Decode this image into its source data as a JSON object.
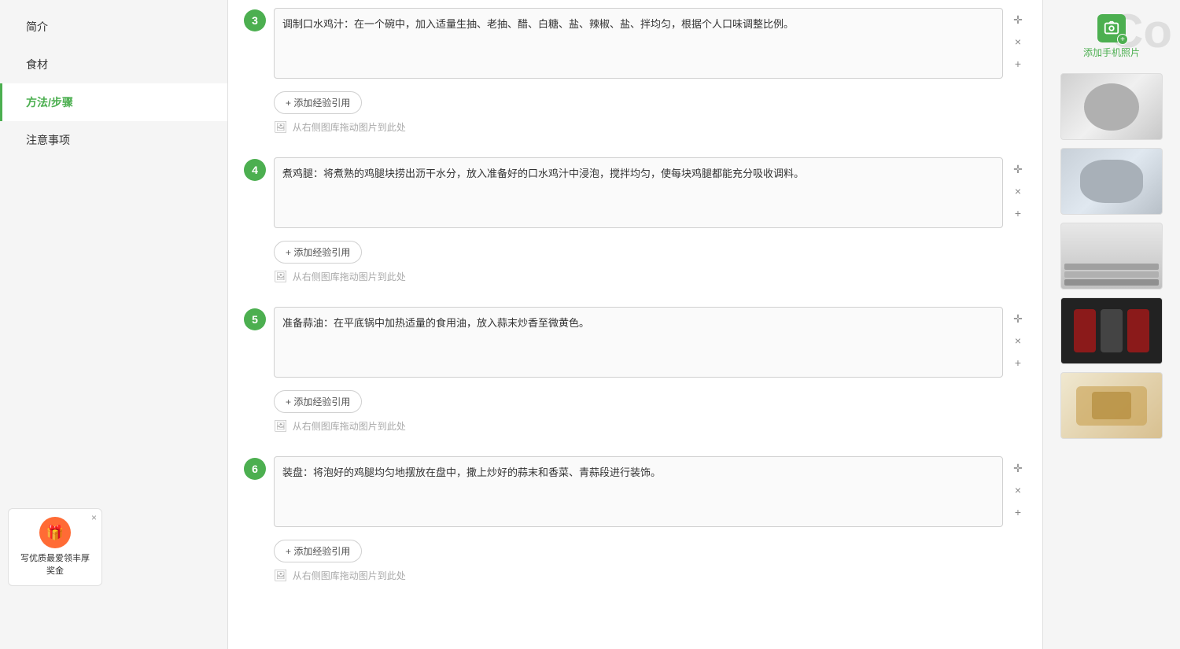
{
  "sidebar": {
    "items": [
      {
        "id": "intro",
        "label": "简介",
        "active": false
      },
      {
        "id": "ingredients",
        "label": "食材",
        "active": false
      },
      {
        "id": "method",
        "label": "方法/步骤",
        "active": true
      },
      {
        "id": "notes",
        "label": "注意事项",
        "active": false
      }
    ]
  },
  "award": {
    "close_symbol": "×",
    "icon": "🎁",
    "text": "写优质最爱领丰厚奖金"
  },
  "steps": [
    {
      "number": "3",
      "text": "调制口水鸡汁：在一个碗中，加入适量生抽、老抽、醋、白糖、盐、辣椒、盐、拌均匀，根据个人口味调整比例。",
      "add_exp_label": "+ 添加经验引用",
      "upload_label": "从右侧图库拖动图片到此处"
    },
    {
      "number": "4",
      "text": "煮鸡腿：将煮熟的鸡腿块捞出沥干水分，放入准备好的口水鸡汁中浸泡，搅拌均匀，使每块鸡腿都能充分吸收调料。",
      "has_cursor": true,
      "add_exp_label": "+ 添加经验引用",
      "upload_label": "从右侧图库拖动图片到此处"
    },
    {
      "number": "5",
      "text": "准备蒜油：在平底锅中加热适量的食用油，放入蒜末炒香至微黄色。",
      "add_exp_label": "+ 添加经验引用",
      "upload_label": "从右侧图库拖动图片到此处"
    },
    {
      "number": "6",
      "text": "装盘：将泡好的鸡腿均匀地摆放在盘中，撒上炒好的蒜末和香菜、青蒜段进行装饰。",
      "add_exp_label": "+ 添加经验引用",
      "upload_label": "从右侧图库拖动图片到此处"
    }
  ],
  "right_panel": {
    "add_photo_label": "添加手机照片",
    "thumbnails": [
      {
        "id": 1,
        "class": "thumb-1"
      },
      {
        "id": 2,
        "class": "thumb-2"
      },
      {
        "id": 3,
        "class": "thumb-3"
      },
      {
        "id": 4,
        "class": "thumb-4"
      },
      {
        "id": 5,
        "class": "thumb-5"
      }
    ]
  },
  "controls": {
    "move_symbol": "✛",
    "delete_symbol": "×",
    "add_symbol": "+"
  },
  "watermark": "Co"
}
